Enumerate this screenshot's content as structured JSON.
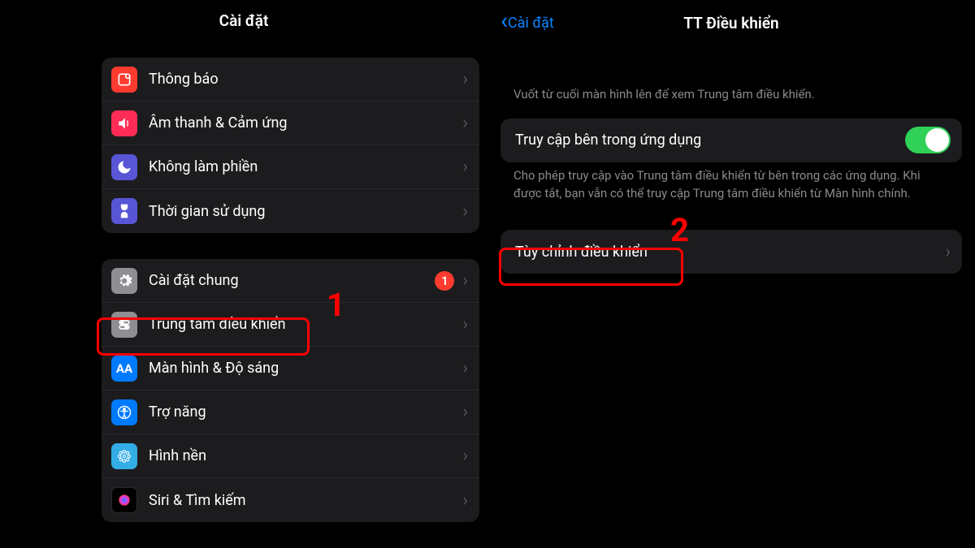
{
  "left": {
    "title": "Cài đặt",
    "group1": [
      {
        "label": "Thông báo"
      },
      {
        "label": "Âm thanh & Cảm ứng"
      },
      {
        "label": "Không làm phiền"
      },
      {
        "label": "Thời gian sử dụng"
      }
    ],
    "group2": [
      {
        "label": "Cài đặt chung",
        "badge": "1"
      },
      {
        "label": "Trung tâm điều khiển"
      },
      {
        "label": "Màn hình & Độ sáng"
      },
      {
        "label": "Trợ năng"
      },
      {
        "label": "Hình nền"
      },
      {
        "label": "Siri & Tìm kiếm"
      }
    ]
  },
  "right": {
    "back": "Cài đặt",
    "title": "TT Điều khiển",
    "helper_top": "Vuốt từ cuối màn hình lên để xem Trung tâm điều khiển.",
    "access_label": "Truy cập bên trong ứng dụng",
    "access_on": true,
    "helper_mid": "Cho phép truy cập vào Trung tâm điều khiển từ bên trong các ứng dụng. Khi được tắt, bạn vẫn có thể truy cập Trung tâm điều khiển từ Màn hình chính.",
    "customize_label": "Tùy chỉnh điều khiển"
  },
  "annotations": {
    "n1": "1",
    "n2": "2"
  }
}
